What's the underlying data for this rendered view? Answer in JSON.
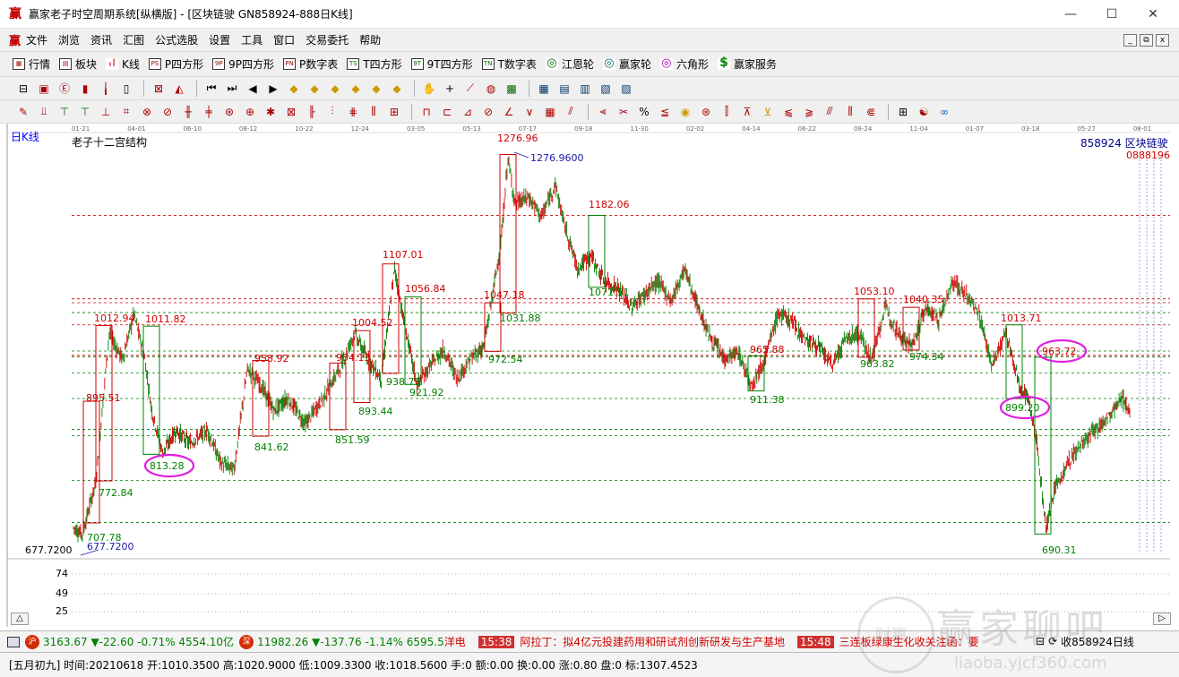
{
  "window": {
    "title": "赢家老子时空周期系统[纵横版] - [区块链驶  GN858924-888日K线]",
    "minimize": "—",
    "maximize": "☐",
    "close": "✕"
  },
  "menu": {
    "logo": "赢",
    "items": [
      "文件",
      "浏览",
      "资讯",
      "汇图",
      "公式选股",
      "设置",
      "工具",
      "窗口",
      "交易委托",
      "帮助"
    ],
    "mdi_controls": [
      "_",
      "⧉",
      "x"
    ]
  },
  "toolbar1": [
    {
      "label": "行情",
      "icon": "grid-icon"
    },
    {
      "label": "板块",
      "icon": "blocks-icon"
    },
    {
      "label": "K线",
      "icon": "kline-icon"
    },
    {
      "label": "P四方形",
      "icon": "P-icon",
      "glyph": "PS"
    },
    {
      "label": "9P四方形",
      "icon": "9P-icon",
      "glyph": "9P"
    },
    {
      "label": "P数字表",
      "icon": "PN-icon",
      "glyph": "PN"
    },
    {
      "label": "T四方形",
      "icon": "TS-icon",
      "glyph": "TS"
    },
    {
      "label": "9T四方形",
      "icon": "9T-icon",
      "glyph": "9T"
    },
    {
      "label": "T数字表",
      "icon": "TN-icon",
      "glyph": "TN"
    },
    {
      "label": "江恩轮",
      "icon": "gann-wheel-icon",
      "glyph": "◎"
    },
    {
      "label": "赢家轮",
      "icon": "winner-wheel-icon",
      "glyph": "◎"
    },
    {
      "label": "六角形",
      "icon": "hexagon-icon",
      "glyph": "◎"
    },
    {
      "label": "赢家服务",
      "icon": "dollar-icon",
      "glyph": "$"
    }
  ],
  "chart_header": {
    "period": "日K线",
    "indicator": "老子十二宫结构",
    "code_name": "858924  区块链驶",
    "right_values": "0888196"
  },
  "date_axis": [
    "01-21",
    "04-01",
    "06-10",
    "08-12",
    "10-22",
    "12-24",
    "03-05",
    "05-13",
    "07-17",
    "09-18",
    "11-30",
    "02-02",
    "04-14",
    "06-22",
    "08-24",
    "11-04",
    "01-07",
    "03-18",
    "05-27",
    "08-01"
  ],
  "left_axis": {
    "price_low": "677.7200",
    "ticks": [
      "74",
      "49",
      "25"
    ]
  },
  "chart_data": {
    "type": "candlestick",
    "title": "老子十二宫结构",
    "symbol": "858924 区块链驶",
    "period": "日K线",
    "annotations": [
      {
        "label": "1276.96",
        "price": 1276.96,
        "color": "red"
      },
      {
        "label": "1276.9600",
        "price": 1276.96,
        "color": "blue"
      },
      {
        "label": "1182.06",
        "price": 1182.06,
        "color": "red"
      },
      {
        "label": "1107.01",
        "price": 1107.01,
        "color": "red"
      },
      {
        "label": "1071.51",
        "price": 1071.51,
        "color": "green"
      },
      {
        "label": "1056.84",
        "price": 1056.84,
        "color": "red"
      },
      {
        "label": "1053.10",
        "price": 1053.1,
        "color": "red"
      },
      {
        "label": "1047.18",
        "price": 1047.18,
        "color": "red"
      },
      {
        "label": "1040.35",
        "price": 1040.35,
        "color": "red"
      },
      {
        "label": "1031.88",
        "price": 1031.88,
        "color": "green"
      },
      {
        "label": "1013.71",
        "price": 1013.71,
        "color": "red"
      },
      {
        "label": "1012.94",
        "price": 1012.94,
        "color": "red"
      },
      {
        "label": "1011.82",
        "price": 1011.82,
        "color": "red"
      },
      {
        "label": "1004.52",
        "price": 1004.52,
        "color": "red"
      },
      {
        "label": "974.34",
        "price": 974.34,
        "color": "green"
      },
      {
        "label": "972.54",
        "price": 972.54,
        "color": "green"
      },
      {
        "label": "965.88",
        "price": 965.88,
        "color": "red"
      },
      {
        "label": "963.82",
        "price": 963.82,
        "color": "green"
      },
      {
        "label": "963.72",
        "price": 963.72,
        "color": "red",
        "circled": true
      },
      {
        "label": "958.92",
        "price": 958.92,
        "color": "red"
      },
      {
        "label": "954.13",
        "price": 954.13,
        "color": "red"
      },
      {
        "label": "938.75",
        "price": 938.75,
        "color": "green"
      },
      {
        "label": "921.92",
        "price": 921.92,
        "color": "green"
      },
      {
        "label": "911.38",
        "price": 911.38,
        "color": "green"
      },
      {
        "label": "899.20",
        "price": 899.2,
        "color": "green",
        "circled": true
      },
      {
        "label": "895.51",
        "price": 895.51,
        "color": "red"
      },
      {
        "label": "893.44",
        "price": 893.44,
        "color": "green"
      },
      {
        "label": "851.59",
        "price": 851.59,
        "color": "green"
      },
      {
        "label": "841.62",
        "price": 841.62,
        "color": "green"
      },
      {
        "label": "813.28",
        "price": 813.28,
        "color": "green",
        "circled": true
      },
      {
        "label": "772.84",
        "price": 772.84,
        "color": "green"
      },
      {
        "label": "707.78",
        "price": 707.78,
        "color": "green"
      },
      {
        "label": "690.31",
        "price": 690.31,
        "color": "green"
      },
      {
        "label": "677.7200",
        "price": 677.72,
        "color": "blue"
      }
    ],
    "levels_red_dashed": [
      1182.06,
      1053.1,
      1047.18,
      1012.94,
      965.88,
      963.72
    ],
    "levels_green_dashed": [
      1031.88,
      972.54,
      963.82,
      938.75,
      899.2,
      851.59,
      841.62,
      772.84,
      707.78
    ]
  },
  "status1": {
    "sh_badge": "沪",
    "sh": "3163.67 ▼-22.60 -0.71% 4554.10亿",
    "sz_badge": "深",
    "sz": "11982.26 ▼-137.76 -1.14% 6595.5",
    "news_prefix": "洋电",
    "news": [
      {
        "time": "15:38",
        "text": "阿拉丁：拟4亿元投建药用和研试剂创新研发与生产基地"
      },
      {
        "time": "15:48",
        "text": "三连板绿康生化收关注函：要"
      }
    ],
    "right_label": "收858924日线"
  },
  "status2": {
    "text": "[五月初九] 时间:20210618 开:1010.3500 高:1020.9000 低:1009.3300 收:1018.5600 手:0 额:0.00 换:0.00 涨:0.80 盘:0 标:1307.4523"
  },
  "watermark": {
    "main": "赢家聊吧",
    "url": "liaoba.yjcf360.com",
    "badge": "财赢"
  }
}
